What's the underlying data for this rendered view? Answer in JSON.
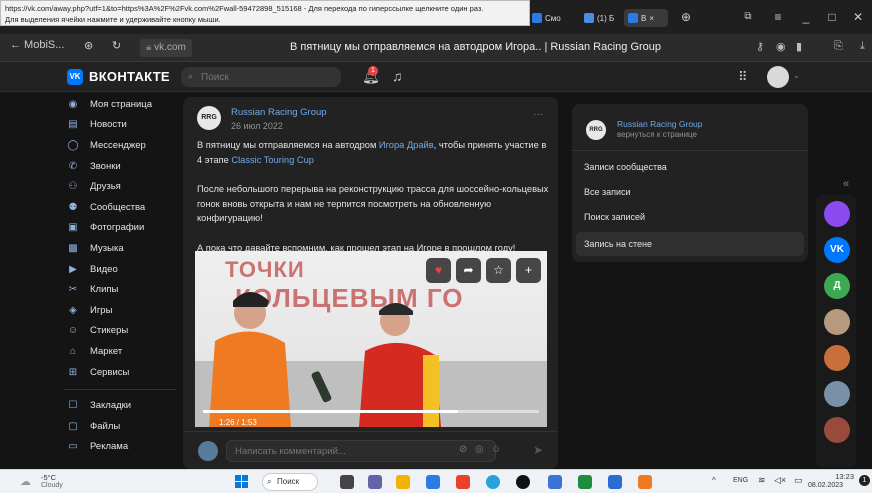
{
  "tooltip": {
    "line1": "https://vk.com/away.php?utf=1&to=https%3A%2F%2Fvk.com%2Fwall-59472898_515168 - Для перехода по гиперссылке щелкните один раз.",
    "line2": "Для выделения ячейки нажмите и удерживайте кнопку мыши."
  },
  "browser": {
    "tabs": [
      {
        "label": "Смо"
      },
      {
        "label": "(1) Б"
      },
      {
        "label": "В"
      }
    ],
    "back_label": "← MobiS...",
    "url": "vk.com",
    "page_title": "В пятницу мы отправляемся на автодром Игора.. | Russian Racing Group"
  },
  "vk": {
    "logo_text": "ВКОНТАКТЕ",
    "search_placeholder": "Поиск",
    "notification_count": "1"
  },
  "nav": {
    "items": [
      {
        "label": "Моя страница",
        "icon": "profile-icon"
      },
      {
        "label": "Новости",
        "icon": "news-icon"
      },
      {
        "label": "Мессенджер",
        "icon": "messenger-icon"
      },
      {
        "label": "Звонки",
        "icon": "phone-icon"
      },
      {
        "label": "Друзья",
        "icon": "friends-icon"
      },
      {
        "label": "Сообщества",
        "icon": "communities-icon"
      },
      {
        "label": "Фотографии",
        "icon": "photo-icon"
      },
      {
        "label": "Музыка",
        "icon": "music-icon"
      },
      {
        "label": "Видео",
        "icon": "video-icon"
      },
      {
        "label": "Клипы",
        "icon": "clips-icon"
      },
      {
        "label": "Игры",
        "icon": "games-icon"
      },
      {
        "label": "Стикеры",
        "icon": "stickers-icon"
      },
      {
        "label": "Маркет",
        "icon": "market-icon"
      },
      {
        "label": "Сервисы",
        "icon": "services-icon"
      }
    ],
    "items2": [
      {
        "label": "Закладки",
        "icon": "bookmarks-icon"
      },
      {
        "label": "Файлы",
        "icon": "files-icon"
      },
      {
        "label": "Реклама",
        "icon": "ads-icon"
      }
    ]
  },
  "post": {
    "author": "Russian Racing Group",
    "date": "26 июл 2022",
    "text1_a": "В пятницу мы отправляемся на автодром ",
    "text1_link1": "Игора Драйв",
    "text1_b": ", чтобы принять участие в 4 этапе ",
    "text1_link2": "Classic Touring Cup",
    "text2": "После небольшого перерыва на реконструкцию трасса для шоссейно-кольцевых гонок вновь открыта и нам не терпится посмотреть на обновленную конфигурацию!",
    "text3": "А пока что давайте вспомним, как прошел этап на Игоре в прошлом году!",
    "video_time": "1:26 / 1:53",
    "video_progress": 0.76,
    "banner_text": "КОЛЬЦЕВЫМ ГО",
    "banner_text_top": "ТОЧКИ",
    "comment_placeholder": "Написать комментарий..."
  },
  "right_panel": {
    "name": "Russian Racing Group",
    "back_label": "вернуться к странице",
    "items": [
      {
        "label": "Записи сообщества",
        "active": false
      },
      {
        "label": "Все записи",
        "active": false
      },
      {
        "label": "Поиск записей",
        "active": false
      },
      {
        "label": "Запись на стене",
        "active": true
      }
    ]
  },
  "chats": [
    {
      "label": "",
      "color": "#8a4cf0"
    },
    {
      "label": "VK",
      "color": "#0077ff"
    },
    {
      "label": "Д",
      "color": "#3da854"
    },
    {
      "label": "",
      "color": "#b59a80"
    },
    {
      "label": "",
      "color": "#c9703a"
    },
    {
      "label": "",
      "color": "#7a8fa8"
    },
    {
      "label": "",
      "color": "#9a4a3a"
    }
  ],
  "taskbar": {
    "weather_temp": "-5°C",
    "weather_desc": "Cloudy",
    "search_label": "Поиск",
    "lang": "ENG",
    "time": "13:23",
    "date": "08.02.2023"
  }
}
